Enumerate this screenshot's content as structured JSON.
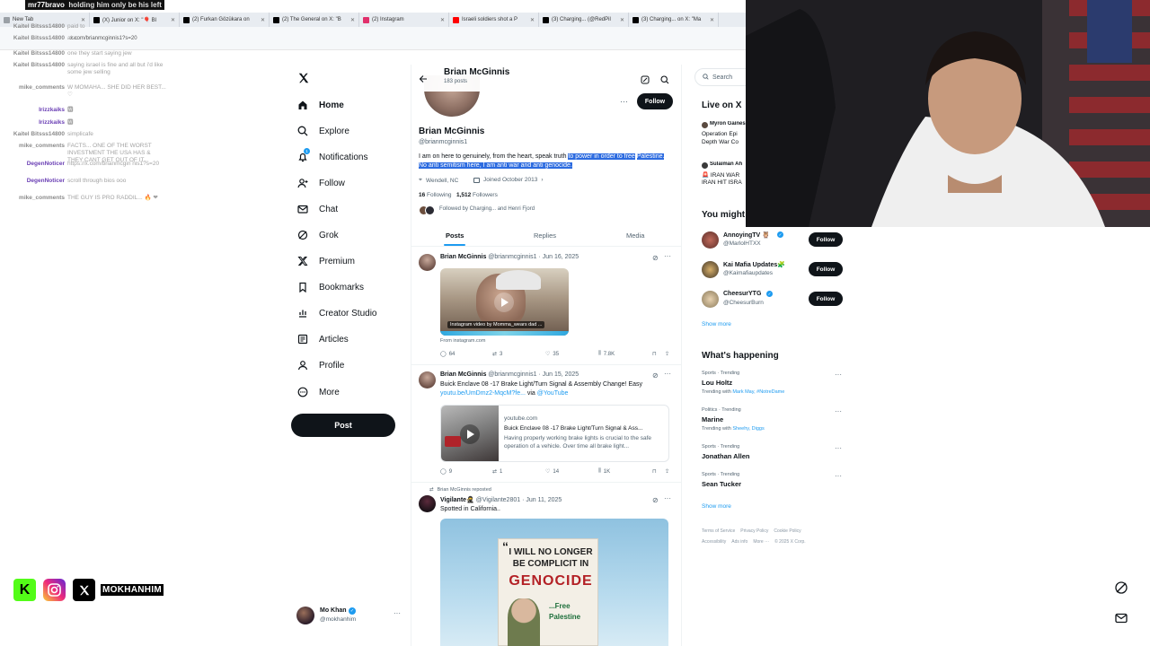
{
  "browser": {
    "tabs": [
      {
        "label": "New Tab",
        "icon": "chrome-icon"
      },
      {
        "label": "(X) Junior on X: \"🎈 Bl",
        "icon": "x-icon"
      },
      {
        "label": "(2) Furkan Gözükara on",
        "icon": "x-icon"
      },
      {
        "label": "(2) The General on X: \"B",
        "icon": "x-icon"
      },
      {
        "label": "(2) Instagram",
        "icon": "instagram-icon"
      },
      {
        "label": "Israeli soldiers shot a P",
        "icon": "youtube-icon"
      },
      {
        "label": "(3) Charging... (@RedPil",
        "icon": "x-icon"
      },
      {
        "label": "(3) Charging... on X: \"Ma",
        "icon": "x-icon"
      }
    ],
    "url": "x.com/brianmcginnis1?s=20"
  },
  "chat": {
    "top": {
      "user": "mr77bravo",
      "message": "holding him only be his left"
    },
    "lines": [
      {
        "user": "Kaitel Bitsss14800",
        "color": "#8b8b8b",
        "message": "paid to"
      },
      {
        "user": "Kaitel Bitsss14800",
        "color": "#8b8b8b",
        "message": "also"
      },
      {
        "user": "Kaitel Bitsss14800",
        "color": "#8b8b8b",
        "message": "one they start saying jew"
      },
      {
        "user": "Kaitel Bitsss14800",
        "color": "#8b8b8b",
        "message": "saying israel is fine and all but i'd like some jew selling"
      },
      {
        "user": "mike_comments",
        "color": "#8b8b8b",
        "message": "W MOMAHA... SHE DID HER BEST... ♡"
      },
      {
        "user": "Irizzkaiks",
        "color": "#6a3fb4",
        "message": "🆆"
      },
      {
        "user": "Irizzkaiks",
        "color": "#6a3fb4",
        "message": "🆆"
      },
      {
        "user": "Kaitel Bitsss14800",
        "color": "#8b8b8b",
        "message": "simplicafe"
      },
      {
        "user": "mike_comments",
        "color": "#8b8b8b",
        "message": "FACTS... ONE OF THE WORST INVESTMENT THE USA HAS & THEY CANT GET OUT OF IT..."
      },
      {
        "user": "DegenNoticer",
        "color": "#6a3fb4",
        "message": "https://x.com/brianmcgin nis1?s=20"
      },
      {
        "user": "DegenNoticer",
        "color": "#6a3fb4",
        "message": "scroll through bios ooo"
      },
      {
        "user": "mike_comments",
        "color": "#8b8b8b",
        "message": "THE GUY IS PRO RADDIL... 🔥 ❤"
      }
    ]
  },
  "nav": {
    "items": [
      {
        "label": "Home",
        "icon": "home-icon"
      },
      {
        "label": "Explore",
        "icon": "search-icon"
      },
      {
        "label": "Notifications",
        "icon": "bell-icon",
        "badge": "1"
      },
      {
        "label": "Follow",
        "icon": "follow-icon"
      },
      {
        "label": "Chat",
        "icon": "mail-icon"
      },
      {
        "label": "Grok",
        "icon": "grok-icon"
      },
      {
        "label": "Premium",
        "icon": "x-premium-icon"
      },
      {
        "label": "Bookmarks",
        "icon": "bookmark-icon"
      },
      {
        "label": "Creator Studio",
        "icon": "creator-studio-icon"
      },
      {
        "label": "Articles",
        "icon": "articles-icon"
      },
      {
        "label": "Profile",
        "icon": "profile-icon"
      },
      {
        "label": "More",
        "icon": "more-circle-icon"
      }
    ],
    "post_label": "Post",
    "account": {
      "name": "Mo Khan",
      "handle": "@mokhanhim"
    }
  },
  "header": {
    "name": "Brian McGinnis",
    "posts": "183 posts"
  },
  "profile": {
    "name": "Brian McGinnis",
    "handle": "@brianmcginnis1",
    "bio_plain": "I am on here to genuinely, from the heart, speak truth",
    "bio_highlight_1": "to power in order to free",
    "bio_highlight_2": "Palestine. No anti semitism here, I am anti war and anti genocide.",
    "location": "Wendell, NC",
    "joined": "Joined October 2013",
    "following_count": "16",
    "following_label": "Following",
    "followers_count": "1,512",
    "followers_label": "Followers",
    "followed_by": "Followed by Charging... and Henri Fjord",
    "follow_label": "Follow"
  },
  "profile_tabs": [
    "Posts",
    "Replies",
    "Media"
  ],
  "tweets": [
    {
      "name": "Brian McGinnis",
      "handle": "@brianmcginnis1",
      "date": "Jun 16, 2025",
      "media_caption": "Instagram video by Momma_wears dad ...",
      "source": "From instagram.com",
      "replies": "64",
      "reposts": "3",
      "likes": "35",
      "views": "7.8K"
    },
    {
      "name": "Brian McGinnis",
      "handle": "@brianmcginnis1",
      "date": "Jun 15, 2025",
      "text": "Buick Enclave 08 -17 Brake Light/Turn Signal & Assembly Change! Easy",
      "link": "youtu.be/UmDmz2-MqcM?fe...",
      "link_suffix": "via",
      "link_via": "@YouTube",
      "card_domain": "youtube.com",
      "card_title": "Buick Enclave 08 -17 Brake Light/Turn Signal & Ass...",
      "card_desc": "Having properly working brake lights is crucial to the safe operation of a vehicle. Over time all brake light...",
      "replies": "9",
      "reposts": "1",
      "likes": "14",
      "views": "1K"
    },
    {
      "reposted_by": "Brian McGinnis reposted",
      "name": "Vigilante🥷",
      "handle": "@Vigilante2801",
      "date": "Jun 11, 2025",
      "text": "Spotted in California..",
      "billboard_line1": "I WILL NO LONGER",
      "billboard_line2": "BE COMPLICIT IN",
      "billboard_line3": "GENOCIDE",
      "billboard_line4": "...Free",
      "billboard_line5": "Palestine"
    }
  ],
  "right": {
    "search_placeholder": "Search",
    "live_title": "Live on X",
    "live": [
      {
        "host": "Myron Gaines",
        "title_1": "Operation Epi",
        "title_2": "Depth War Co"
      },
      {
        "host": "Sulaiman Ah",
        "title_1": "🚨 IRAN WAR",
        "title_2": "IRAN HIT ISRA"
      }
    ],
    "wtf_title": "You might like",
    "wtf_title_visible": "You might",
    "wtf": [
      {
        "name": "AnnoyingTV 🦉",
        "handle": "@MarlolHTXX"
      },
      {
        "name": "Kai Mafia Updates🧩",
        "handle": "@Kaimafiaupdates"
      },
      {
        "name": "CheesurYTG",
        "handle": "@CheesurBurn"
      }
    ],
    "follow_label": "Follow",
    "show_more": "Show more",
    "happening_title": "What's happening",
    "trends": [
      {
        "category": "Sports · Trending",
        "name": "Lou Holtz",
        "with_label": "Trending with",
        "with": "Mark May, #NotreDame"
      },
      {
        "category": "Politics · Trending",
        "name": "Marine",
        "with_label": "Trending with",
        "with": "Sheehy, Diggs"
      },
      {
        "category": "Sports · Trending",
        "name": "Jonathan Allen",
        "with_label": "",
        "with": ""
      },
      {
        "category": "Sports · Trending",
        "name": "Sean Tucker",
        "with_label": "",
        "with": ""
      }
    ],
    "footer_1": [
      "Terms of Service",
      "Privacy Policy",
      "Cookie Policy"
    ],
    "footer_2": [
      "Accessibility",
      "Ads info",
      "More ···",
      "© 2025 X Corp."
    ]
  },
  "socials": {
    "handle": "MOKHANHIM"
  },
  "colors": {
    "accent": "#1d9bf0",
    "highlight": "#2c6be0",
    "dark": "#0f1419",
    "muted": "#536471"
  }
}
